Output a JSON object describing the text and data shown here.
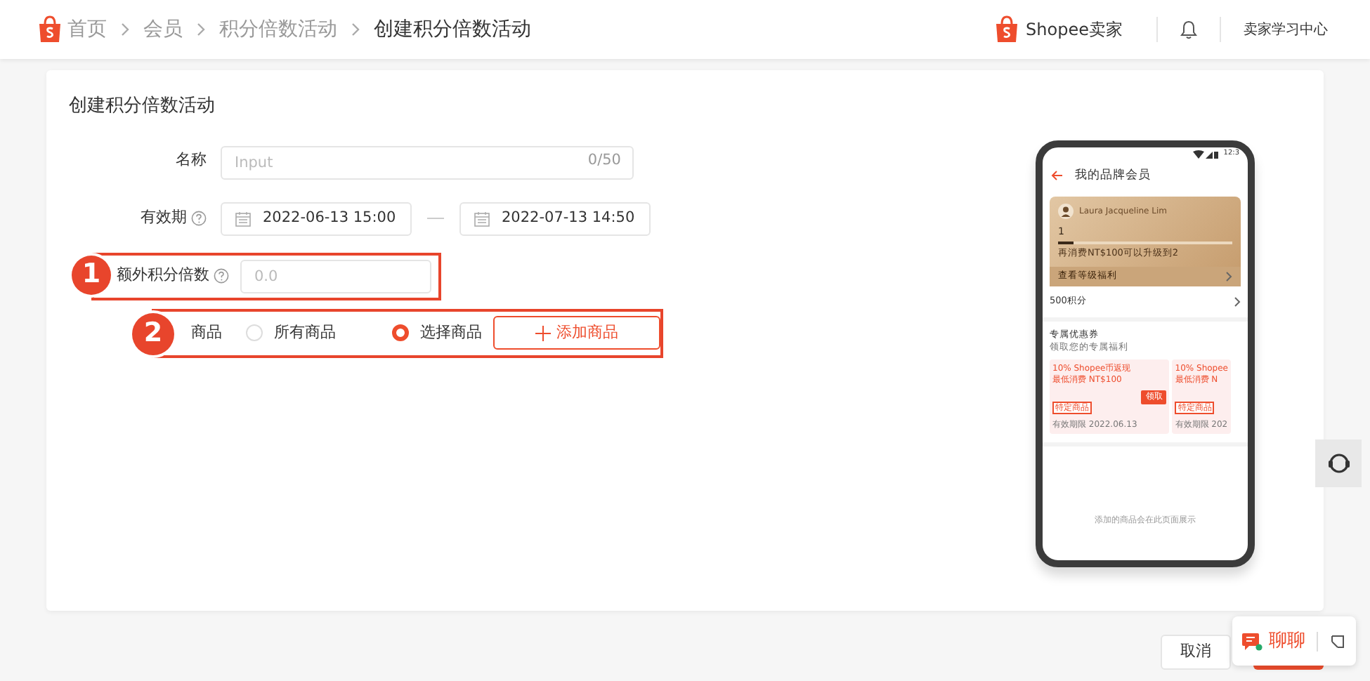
{
  "header": {
    "breadcrumbs": [
      {
        "label": "首页",
        "current": false
      },
      {
        "label": "会员",
        "current": false
      },
      {
        "label": "积分倍数活动",
        "current": false
      },
      {
        "label": "创建积分倍数活动",
        "current": true
      }
    ],
    "brand": "Shopee卖家",
    "learning_link": "卖家学习中心"
  },
  "form": {
    "title": "创建积分倍数活动",
    "name": {
      "label": "名称",
      "placeholder": "Input",
      "counter": "0/50"
    },
    "period": {
      "label": "有效期",
      "start": "2022-06-13 15:00",
      "end": "2022-07-13 14:50"
    },
    "multiplier": {
      "label": "额外积分倍数",
      "placeholder": "0.0",
      "step": "1"
    },
    "products": {
      "label": "商品",
      "step": "2",
      "options": [
        {
          "label": "所有商品",
          "selected": false
        },
        {
          "label": "选择商品",
          "selected": true
        }
      ],
      "add_button": "添加商品"
    }
  },
  "preview": {
    "time": "12:3",
    "title": "我的品牌会员",
    "member_name": "Laura Jacqueline Lim",
    "level": "1",
    "upgrade_hint": "再消费NT$100可以升级到2",
    "benefits_link": "查看等级福利",
    "points": "500积分",
    "coupons_title": "专属优惠券",
    "coupons_subtitle": "领取您的专属福利",
    "coupons": [
      {
        "line_1": "10% Shopee币返现",
        "line_2": "最低消费 NT$100",
        "tag": "特定商品",
        "validity": "有效期限 2022.06.13",
        "claim": "领取"
      },
      {
        "line_1": "10% Shopee",
        "line_2": "最低消费 N",
        "tag": "特定商品",
        "validity": "有效期限 202"
      }
    ],
    "empty_text": "添加的商品会在此页面展示"
  },
  "footer": {
    "cancel": "取消"
  },
  "chat": {
    "label": "聊聊"
  }
}
